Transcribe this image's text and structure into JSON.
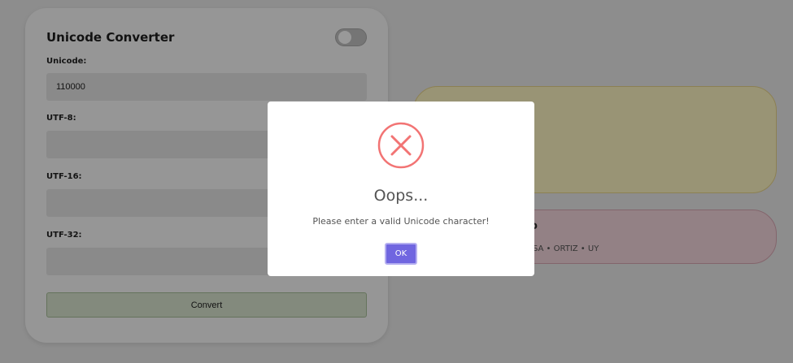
{
  "converter": {
    "title": "Unicode Converter",
    "unicode_label": "Unicode:",
    "unicode_value": "110000",
    "utf8_label": "UTF-8:",
    "utf8_value": "",
    "utf16_label": "UTF-16:",
    "utf16_value": "",
    "utf32_label": "UTF-32:",
    "utf32_value": "",
    "convert_label": "Convert",
    "dark_mode_toggle_on": false
  },
  "info_panel": {
    "heading_fragment": "o",
    "credits_fragment": "SA • ORTIZ • UY"
  },
  "dialog": {
    "title": "Oops...",
    "message": "Please enter a valid Unicode character!",
    "ok_label": "OK",
    "icon": "error-x-icon",
    "icon_color": "#f27474",
    "button_color": "#7066e0"
  },
  "colors": {
    "convert_button": "#dbe6d1",
    "yellow_panel": "#fff7c4",
    "pink_panel": "#f5d8de"
  }
}
